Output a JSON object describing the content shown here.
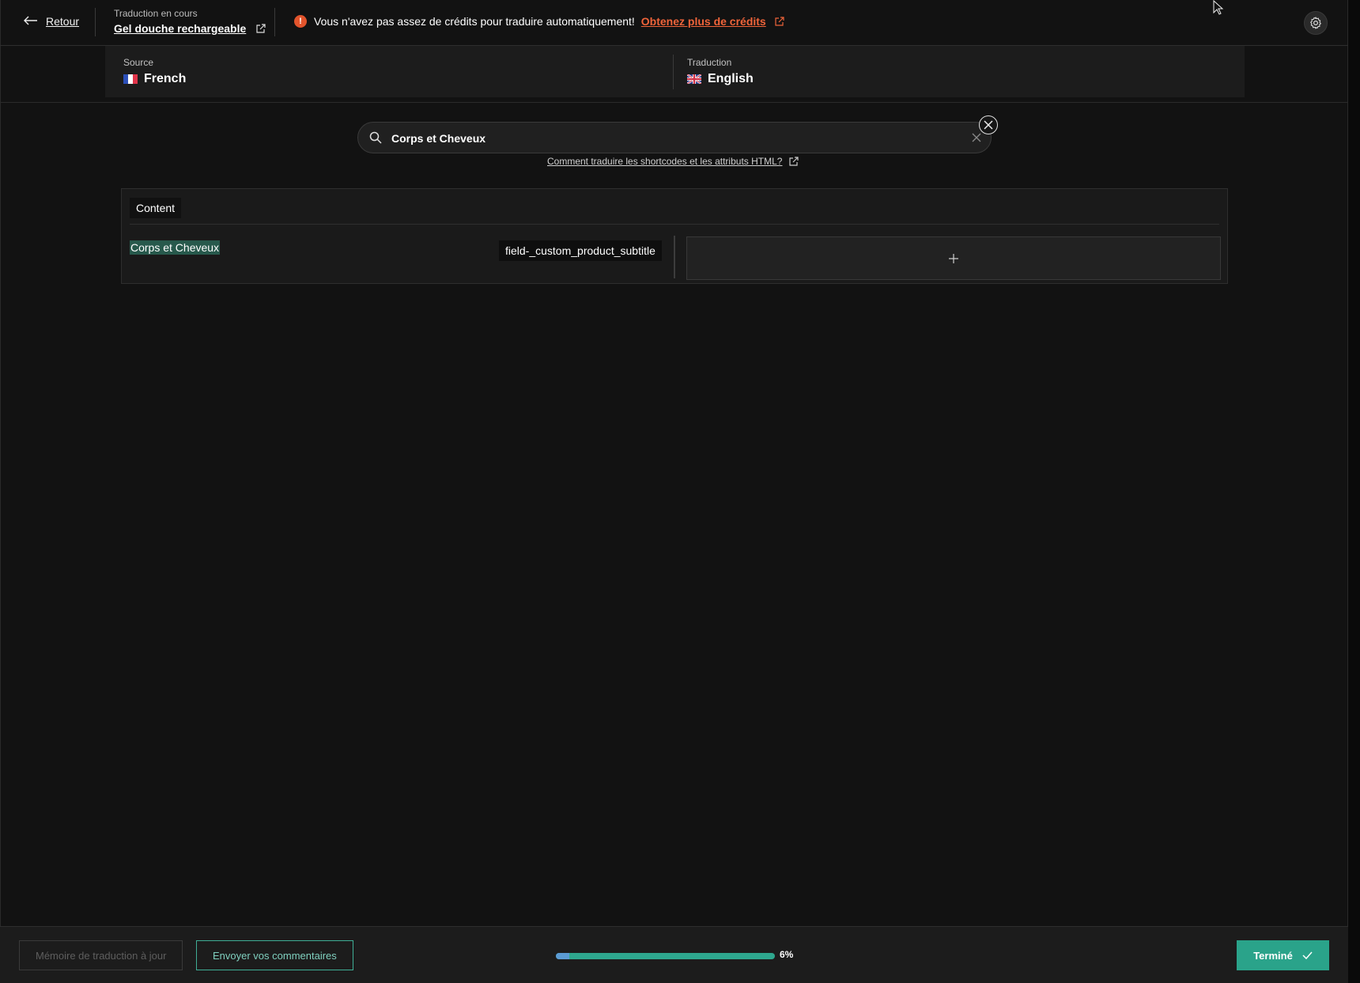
{
  "header": {
    "back_label": "Retour",
    "status_label": "Traduction en cours",
    "doc_title": "Gel douche rechargeable",
    "warning_text": "Vous n'avez pas assez de crédits pour traduire automatiquement!",
    "warning_link": "Obtenez plus de crédits",
    "warning_badge": "!"
  },
  "languages": {
    "source_caption": "Source",
    "source_lang": "French",
    "target_caption": "Traduction",
    "target_lang": "English"
  },
  "search": {
    "value": "Corps et Cheveux",
    "help_link": "Comment traduire les shortcodes et les attributs HTML?"
  },
  "content": {
    "section_label": "Content",
    "rows": [
      {
        "source_text": "Corps et Cheveux",
        "field": "field-_custom_product_subtitle",
        "translation": ""
      }
    ],
    "add_icon": "+"
  },
  "footer": {
    "memory_button": "Mémoire de traduction à jour",
    "feedback_button": "Envoyer vos commentaires",
    "progress_percent": 6,
    "progress_label": "6%",
    "done_button": "Terminé"
  },
  "colors": {
    "accent": "#2aa38a",
    "warning": "#e2542c",
    "highlight": "#27594c"
  }
}
